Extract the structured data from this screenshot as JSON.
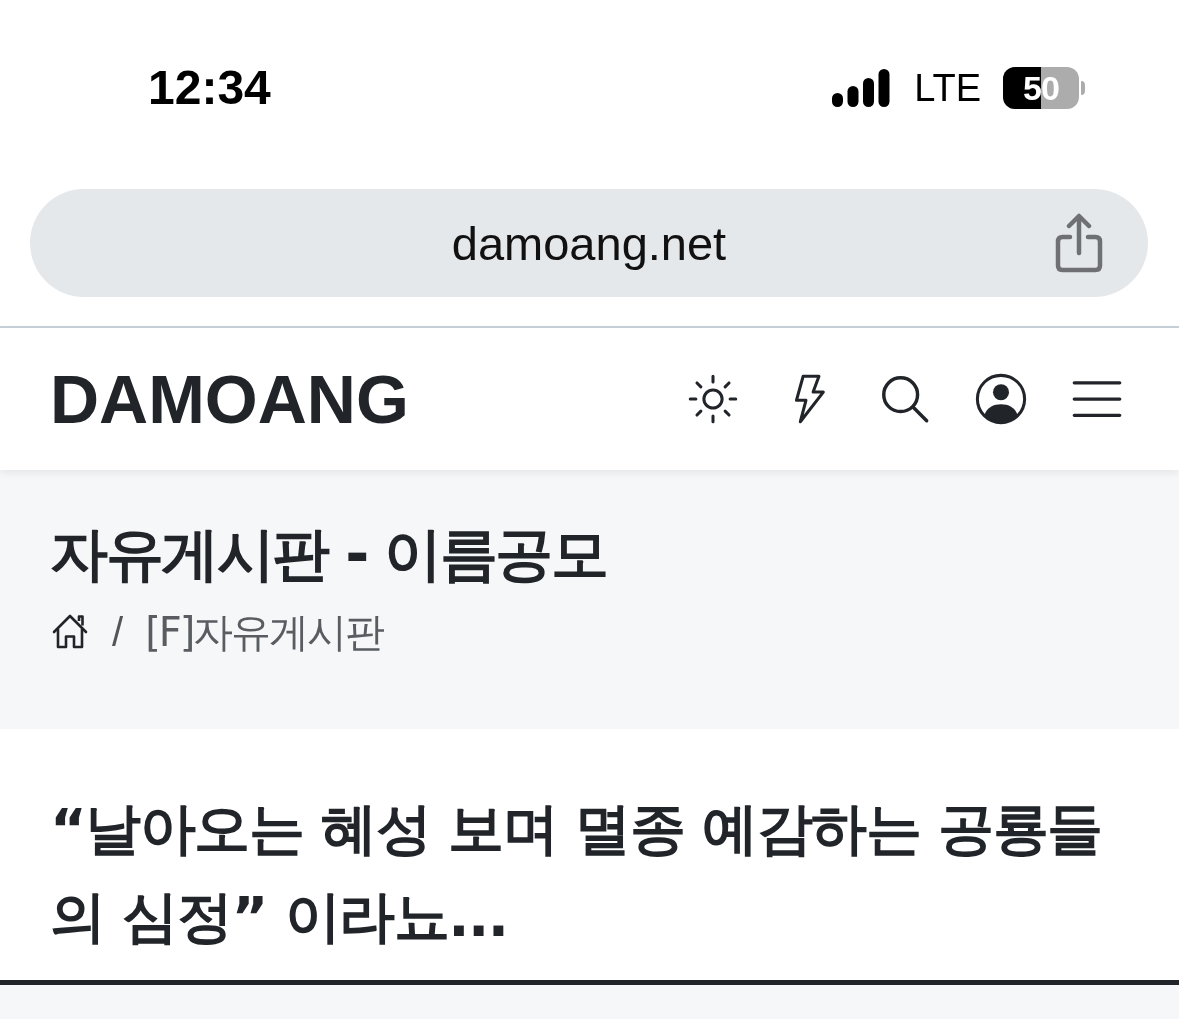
{
  "status_bar": {
    "time": "12:34",
    "network": "LTE",
    "battery": "50"
  },
  "address_bar": {
    "url": "damoang.net"
  },
  "header": {
    "logo": "DAMOANG"
  },
  "board": {
    "title": "자유게시판 - 이름공모",
    "breadcrumb": {
      "separator": "/",
      "items": [
        {
          "kind": "home"
        },
        {
          "kind": "link",
          "label": "[F]자유게시판"
        }
      ]
    }
  },
  "post": {
    "title": "“날아오는 혜성 보며 멸종 예감하는 공룡들의 심정” 이라뇨..."
  }
}
